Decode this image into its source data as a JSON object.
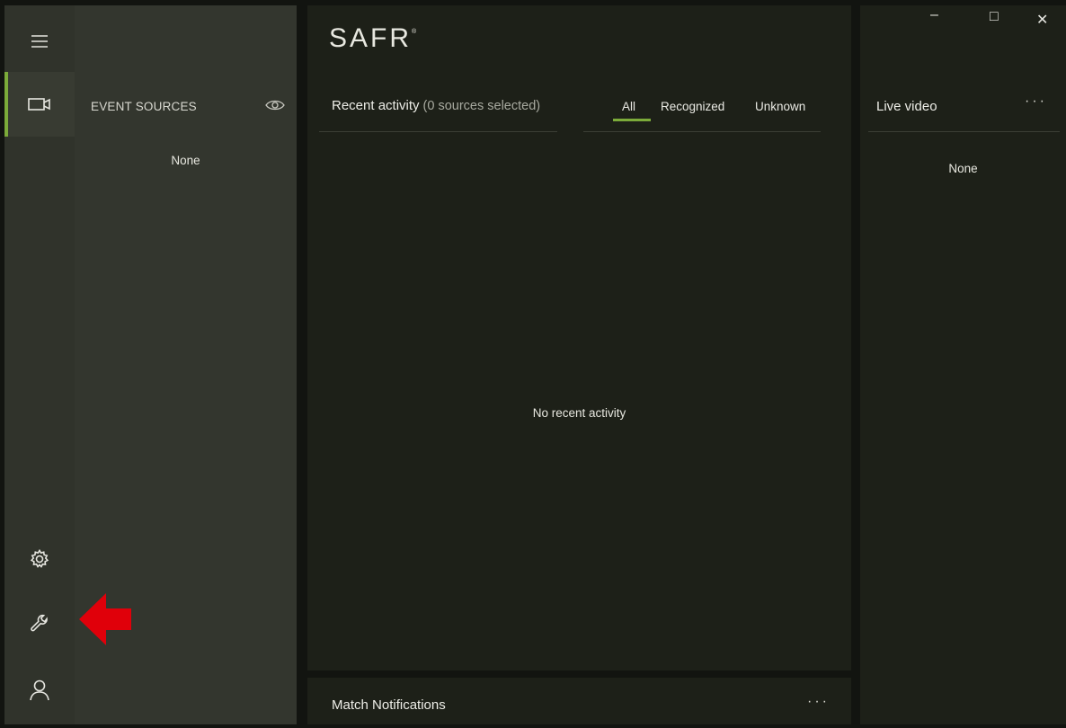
{
  "app": {
    "logo_text": "SAFR",
    "logo_mark": "®"
  },
  "sidebar": {
    "items": [
      {
        "name": "menu",
        "icon": "hamburger-icon"
      },
      {
        "name": "event-sources",
        "icon": "video-camera-icon",
        "active": true
      },
      {
        "name": "settings",
        "icon": "gear-icon"
      },
      {
        "name": "tools",
        "icon": "wrench-icon"
      },
      {
        "name": "account",
        "icon": "user-icon"
      }
    ]
  },
  "event_sources": {
    "title": "EVENT SOURCES",
    "empty_text": "None",
    "toggle_icon": "eye-icon"
  },
  "recent_activity": {
    "title": "Recent activity",
    "subtitle": "(0 sources selected)",
    "tabs": [
      {
        "label": "All",
        "selected": true
      },
      {
        "label": "Recognized",
        "selected": false
      },
      {
        "label": "Unknown",
        "selected": false
      }
    ],
    "empty_text": "No recent activity"
  },
  "match_notifications": {
    "title": "Match Notifications",
    "more_label": "···"
  },
  "live_video": {
    "title": "Live video",
    "more_label": "···",
    "empty_text": "None"
  },
  "window_controls": {
    "minimize": "–",
    "maximize": "□",
    "close": "✕"
  },
  "colors": {
    "accent": "#7cab3a",
    "annotation_arrow": "#e0000a"
  }
}
